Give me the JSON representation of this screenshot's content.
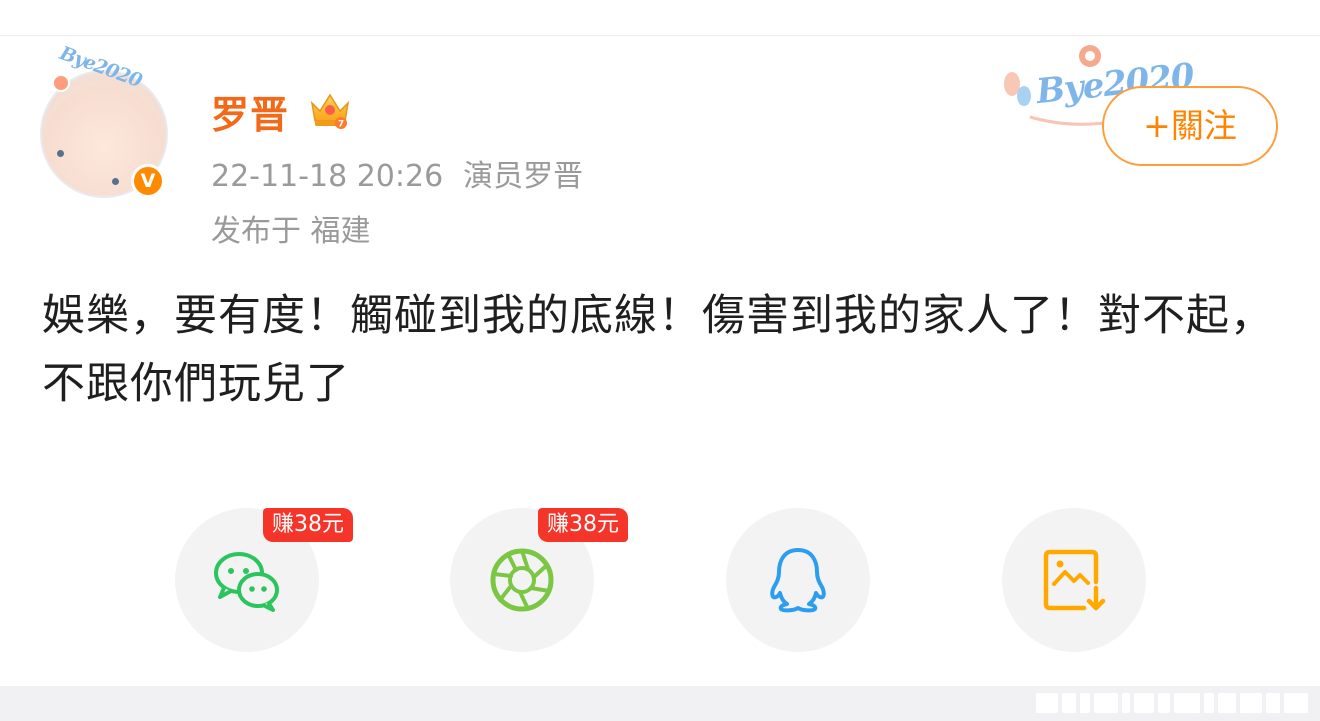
{
  "user": {
    "name": "罗晋",
    "verified_mark": "V"
  },
  "post": {
    "time": "22-11-18 20:26",
    "source": "演员罗晋",
    "location": "发布于 福建",
    "text": "娛樂，要有度！觸碰到我的底線！傷害到我的家人了！對不起，不跟你們玩兒了"
  },
  "follow": {
    "label": "+關注"
  },
  "decor": {
    "avatar_text": "Bye2020",
    "card_text": "Bye2020"
  },
  "share": {
    "items": [
      {
        "icon": "wechat-icon",
        "badge": "赚38元"
      },
      {
        "icon": "moments-icon",
        "badge": "赚38元"
      },
      {
        "icon": "qq-icon",
        "badge": ""
      },
      {
        "icon": "save-image-icon",
        "badge": ""
      }
    ]
  },
  "colors": {
    "username": "#f26a19",
    "accent": "#ff8200",
    "badge": "#f5352a",
    "wechat": "#2bc45d",
    "moments": "#7bc642",
    "qq": "#2d9df0",
    "save": "#ffa800"
  }
}
